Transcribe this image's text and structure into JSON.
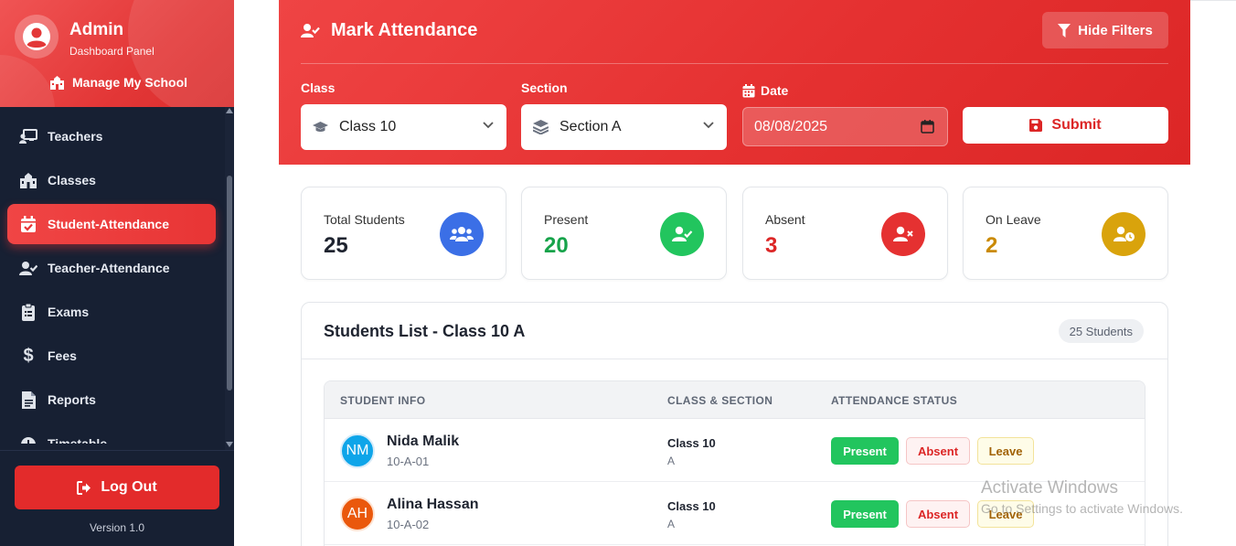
{
  "sidebar": {
    "title": "Admin",
    "subtitle": "Dashboard Panel",
    "manage_label": "Manage My School",
    "items": [
      {
        "label": "Teachers",
        "icon": "teacher-icon"
      },
      {
        "label": "Classes",
        "icon": "school-icon"
      },
      {
        "label": "Student-Attendance",
        "icon": "calendar-check-icon",
        "active": true
      },
      {
        "label": "Teacher-Attendance",
        "icon": "user-check-icon"
      },
      {
        "label": "Exams",
        "icon": "clipboard-icon"
      },
      {
        "label": "Fees",
        "icon": "dollar-icon"
      },
      {
        "label": "Reports",
        "icon": "file-icon"
      },
      {
        "label": "Timetable",
        "icon": "clock-icon"
      }
    ],
    "logout_label": "Log Out",
    "version": "Version 1.0"
  },
  "header": {
    "title": "Mark Attendance",
    "hide_filters_label": "Hide Filters"
  },
  "filters": {
    "class_label": "Class",
    "class_value": "Class 10",
    "section_label": "Section",
    "section_value": "Section A",
    "date_label": "Date",
    "date_value": "08/08/2025",
    "submit_label": "Submit"
  },
  "stats": [
    {
      "label": "Total Students",
      "value": "25",
      "color": "#1f2430",
      "icon_bg": "#3b6fe6",
      "icon": "users-icon"
    },
    {
      "label": "Present",
      "value": "20",
      "color": "#16a34a",
      "icon_bg": "#22c55e",
      "icon": "user-check-icon"
    },
    {
      "label": "Absent",
      "value": "3",
      "color": "#dc2626",
      "icon_bg": "#e53131",
      "icon": "user-x-icon"
    },
    {
      "label": "On Leave",
      "value": "2",
      "color": "#ca8a04",
      "icon_bg": "#d9a30c",
      "icon": "user-clock-icon"
    }
  ],
  "list": {
    "title": "Students List - Class 10 A",
    "badge": "25 Students",
    "columns": [
      "STUDENT INFO",
      "CLASS & SECTION",
      "ATTENDANCE STATUS"
    ],
    "rows": [
      {
        "initials": "NM",
        "avatar_color": "#0ea5e9",
        "name": "Nida Malik",
        "roll": "10-A-01",
        "class": "Class 10",
        "section": "A"
      },
      {
        "initials": "AH",
        "avatar_color": "#ea580c",
        "name": "Alina Hassan",
        "roll": "10-A-02",
        "class": "Class 10",
        "section": "A"
      }
    ],
    "btn_present": "Present",
    "btn_absent": "Absent",
    "btn_leave": "Leave"
  },
  "watermark": {
    "line1": "Activate Windows",
    "line2": "Go to Settings to activate Windows."
  },
  "colors": {
    "accent": "#e53131",
    "sidebar_bg": "#172033"
  }
}
